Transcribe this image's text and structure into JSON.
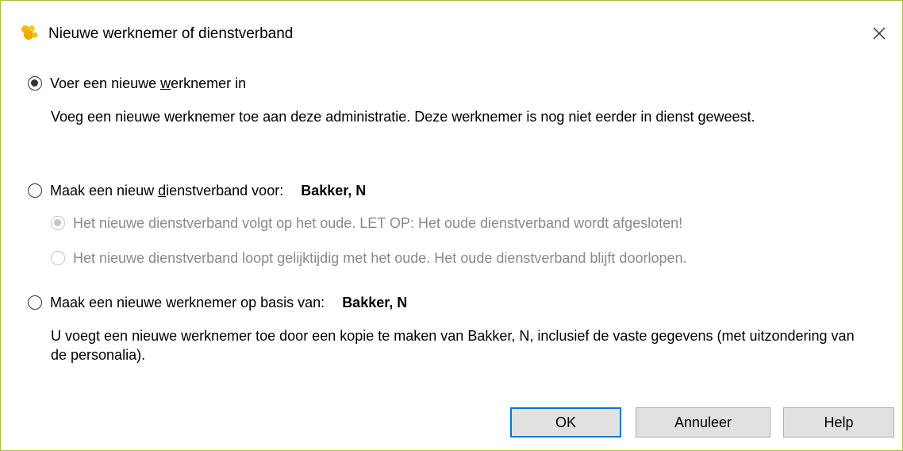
{
  "window": {
    "title": "Nieuwe werknemer of dienstverband",
    "app_icon": "yellow-logo-icon",
    "close_icon": "close-icon"
  },
  "options": {
    "new_employee": {
      "label_pre": "Voer een nieuwe ",
      "label_u": "w",
      "label_post": "erknemer in",
      "checked": true,
      "description": "Voeg een nieuwe werknemer toe aan deze administratie. Deze werknemer is nog niet eerder in dienst geweest."
    },
    "new_employment": {
      "label_pre": "Maak een nieuw ",
      "label_u": "d",
      "label_post": "ienstverband voor:",
      "name": "Bakker, N",
      "checked": false,
      "sub_follows": "Het nieuwe dienstverband volgt op het oude. LET OP: Het oude dienstverband wordt afgesloten!",
      "sub_parallel": "Het nieuwe dienstverband loopt gelijktijdig met het oude. Het oude dienstverband blijft doorlopen."
    },
    "copy_employee": {
      "label": "Maak een nieuwe werknemer op basis van:",
      "name": "Bakker, N",
      "checked": false,
      "description": "U voegt een nieuwe werknemer toe door een kopie te maken van Bakker, N, inclusief de vaste gegevens (met uitzondering van de personalia)."
    }
  },
  "buttons": {
    "ok": "OK",
    "cancel": "Annuleer",
    "help": "Help"
  },
  "colors": {
    "accent": "#0078d7",
    "border": "#a9c23f",
    "disabled_text": "#8a8a8a"
  }
}
